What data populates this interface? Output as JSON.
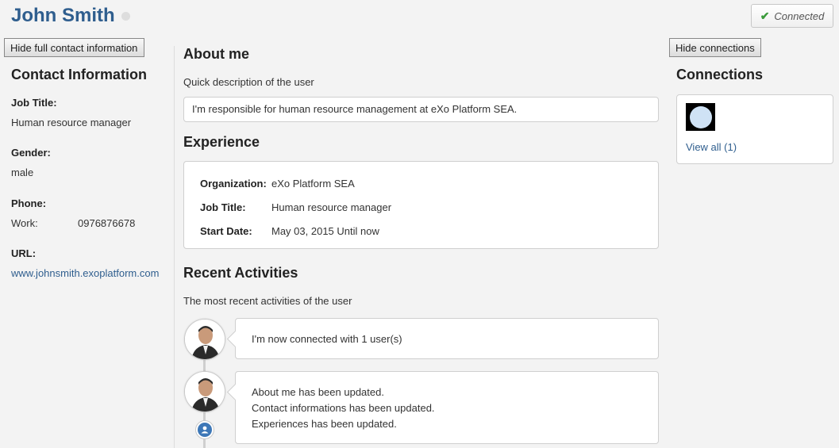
{
  "profile": {
    "name": "John Smith"
  },
  "status": {
    "label": "Connected"
  },
  "buttons": {
    "hide_contact": "Hide full contact information",
    "hide_connections": "Hide connections"
  },
  "contact": {
    "heading": "Contact Information",
    "job_title_label": "Job Title:",
    "job_title": "Human resource manager",
    "gender_label": "Gender:",
    "gender": "male",
    "phone_label": "Phone:",
    "phone_type": "Work:",
    "phone": "0976876678",
    "url_label": "URL:",
    "url": "www.johnsmith.exoplatform.com"
  },
  "about": {
    "heading": "About me",
    "description": "Quick description of the user",
    "text": "I'm responsible for human resource management at eXo Platform SEA."
  },
  "experience": {
    "heading": "Experience",
    "org_label": "Organization:",
    "org": "eXo Platform SEA",
    "job_label": "Job Title:",
    "job": "Human resource manager",
    "start_label": "Start Date:",
    "start": "May 03, 2015 Until now"
  },
  "activities": {
    "heading": "Recent Activities",
    "description": "The most recent activities of the user",
    "items": [
      {
        "lines": [
          "I'm now connected with 1 user(s)"
        ]
      },
      {
        "lines": [
          "About me has been updated.",
          "Contact informations has been updated.",
          "Experiences has been updated."
        ]
      }
    ]
  },
  "connections": {
    "heading": "Connections",
    "view_all": "View all (1)"
  },
  "colors": {
    "accent": "#2f5e8e",
    "success": "#3a9a3a"
  }
}
